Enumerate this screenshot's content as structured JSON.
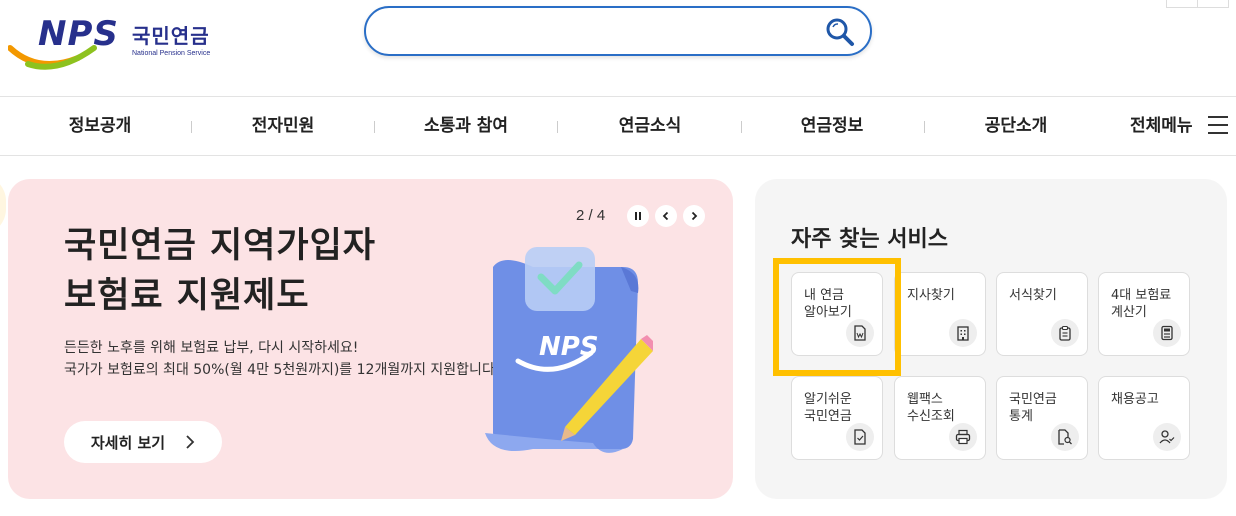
{
  "header": {
    "logo_text": "NPS",
    "logo_korean": "국민연금",
    "logo_english": "National Pension Service",
    "search_value": "",
    "search_placeholder": ""
  },
  "gnb": {
    "items": [
      "정보공개",
      "전자민원",
      "소통과 참여",
      "연금소식",
      "연금정보",
      "공단소개"
    ],
    "all_menu": "전체메뉴"
  },
  "hero": {
    "title_line1": "국민연금 지역가입자",
    "title_line2": "보험료 지원제도",
    "desc_line1": "든든한 노후를 위해 보험료 납부, 다시 시작하세요!",
    "desc_line2": "국가가 보험료의 최대 50%(월 4만 5천원까지)를 12개월까지 지원합니다.",
    "button_label": "자세히 보기",
    "pager": "2 / 4",
    "illust_text": "NPS"
  },
  "services": {
    "title": "자주 찾는 서비스",
    "cards": [
      {
        "line1": "내 연금",
        "line2": "알아보기",
        "icon": "document-won-icon"
      },
      {
        "line1": "지사찾기",
        "line2": "",
        "icon": "building-icon"
      },
      {
        "line1": "서식찾기",
        "line2": "",
        "icon": "clipboard-icon"
      },
      {
        "line1": "4대 보험료",
        "line2": "계산기",
        "icon": "calculator-icon"
      },
      {
        "line1": "알기쉬운",
        "line2": "국민연금",
        "icon": "document-check-icon"
      },
      {
        "line1": "웹팩스",
        "line2": "수신조회",
        "icon": "printer-icon"
      },
      {
        "line1": "국민연금",
        "line2": "통계",
        "icon": "document-search-icon"
      },
      {
        "line1": "채용공고",
        "line2": "",
        "icon": "user-check-icon"
      }
    ]
  },
  "colors": {
    "brand_navy": "#27308c",
    "search_border": "#2a6ec6",
    "hero_bg": "#fce3e5",
    "panel_bg": "#f5f5f5",
    "highlight": "#ffc000"
  }
}
